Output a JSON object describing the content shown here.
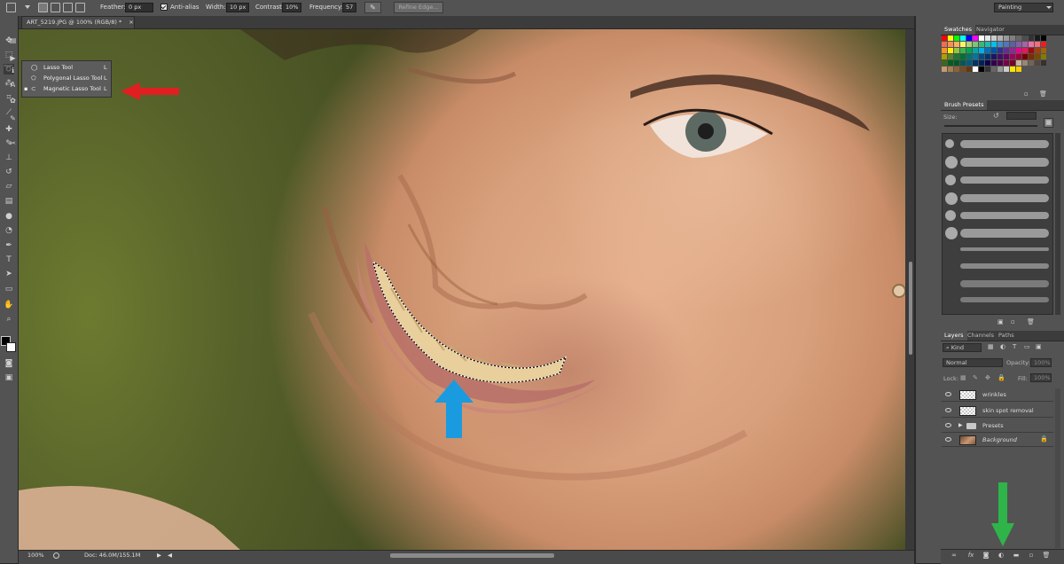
{
  "options_bar": {
    "feather_label": "Feather:",
    "feather_value": "0 px",
    "anti_alias_label": "Anti-alias",
    "width_label": "Width:",
    "width_value": "10 px",
    "contrast_label": "Contrast:",
    "contrast_value": "10%",
    "frequency_label": "Frequency:",
    "frequency_value": "57",
    "refine_edge_label": "Refine Edge...",
    "workspace": "Painting"
  },
  "document": {
    "tab_title": "ART_5219.JPG @ 100% (RGB/8) *",
    "close_glyph": "×"
  },
  "lasso_flyout": [
    {
      "label": "Lasso Tool",
      "shortcut": "L",
      "selected": false
    },
    {
      "label": "Polygonal Lasso Tool",
      "shortcut": "L",
      "selected": false
    },
    {
      "label": "Magnetic Lasso Tool",
      "shortcut": "L",
      "selected": true
    }
  ],
  "status": {
    "zoom": "100%",
    "doc_size": "Doc: 46.0M/155.1M"
  },
  "swatches_panel": {
    "tabs": [
      "Swatches",
      "Navigator"
    ],
    "colors": [
      "#ff0000",
      "#ffff00",
      "#00ff00",
      "#00ffff",
      "#0000ff",
      "#ff00ff",
      "#ffffff",
      "#e6e6e6",
      "#cccccc",
      "#b3b3b3",
      "#999999",
      "#808080",
      "#666666",
      "#4d4d4d",
      "#333333",
      "#1a1a1a",
      "#000000",
      "#f26c4f",
      "#f68e55",
      "#fbaf5d",
      "#fff467",
      "#acd372",
      "#7cc576",
      "#3bb878",
      "#1abbb4",
      "#00bff3",
      "#438ccb",
      "#5574b9",
      "#605ca8",
      "#855fa8",
      "#a763a8",
      "#f06ea9",
      "#f26d7d",
      "#ed1c24",
      "#f7941d",
      "#fff200",
      "#8dc73f",
      "#39b54a",
      "#00a651",
      "#00a99d",
      "#00aeef",
      "#0072bc",
      "#0054a6",
      "#2e3192",
      "#662d91",
      "#92278f",
      "#ec008c",
      "#ed145b",
      "#9e0b0f",
      "#a0410d",
      "#a36209",
      "#aba000",
      "#598527",
      "#1a7b30",
      "#007236",
      "#00746b",
      "#0076a3",
      "#004b80",
      "#003471",
      "#1b1464",
      "#440e62",
      "#630460",
      "#9e005d",
      "#9e0039",
      "#790000",
      "#7b2e00",
      "#7d4900",
      "#827b00",
      "#406618",
      "#005e20",
      "#005826",
      "#005952",
      "#005b7f",
      "#003663",
      "#002157",
      "#0d004c",
      "#32004b",
      "#4b0049",
      "#7b0046",
      "#7a0026",
      "#c7b299",
      "#998675",
      "#736357",
      "#534741",
      "#37302d",
      "#c69c6d",
      "#a67c52",
      "#8c6239",
      "#754c24",
      "#603913",
      "#ffffff",
      "#000000",
      "#333333",
      "#666666",
      "#999999",
      "#cccccc",
      "#ffe600",
      "#ffcc00"
    ]
  },
  "brush_presets_panel": {
    "tab": "Brush Presets",
    "size_label": "Size:"
  },
  "layers_panel": {
    "tabs": [
      "Layers",
      "Channels",
      "Paths"
    ],
    "filter_kind": "Kind",
    "blend_mode": "Normal",
    "opacity_label": "Opacity:",
    "opacity_value": "100%",
    "lock_label": "Lock:",
    "fill_label": "Fill:",
    "fill_value": "100%",
    "layers": [
      {
        "name": "wrinkles",
        "type": "pixel"
      },
      {
        "name": "skin spot removal",
        "type": "pixel"
      },
      {
        "name": "Presets",
        "type": "group"
      },
      {
        "name": "Background",
        "type": "background"
      }
    ]
  },
  "annotations": {
    "red_arrow_color": "#e02020",
    "blue_arrow_color": "#1a9be0",
    "green_arrow_color": "#2fb44a"
  }
}
